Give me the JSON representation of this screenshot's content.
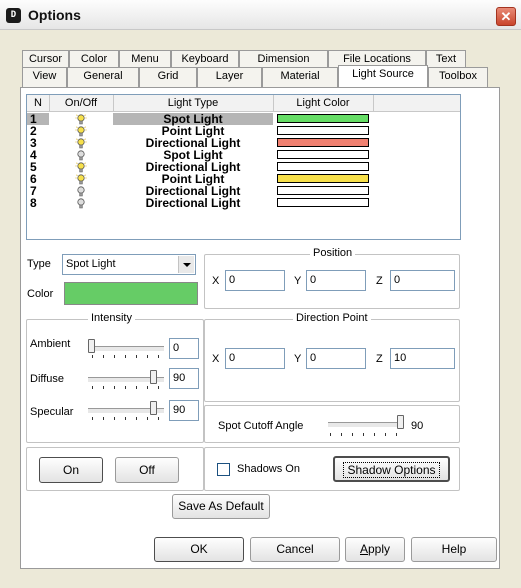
{
  "window": {
    "title": "Options",
    "app_icon": "D"
  },
  "tabs_back": [
    {
      "label": "Cursor"
    },
    {
      "label": "Color"
    },
    {
      "label": "Menu"
    },
    {
      "label": "Keyboard"
    },
    {
      "label": "Dimension"
    },
    {
      "label": "File Locations"
    },
    {
      "label": "Text"
    }
  ],
  "tabs_front": [
    {
      "label": "View"
    },
    {
      "label": "General"
    },
    {
      "label": "Grid"
    },
    {
      "label": "Layer"
    },
    {
      "label": "Material"
    },
    {
      "label": "Light Source"
    },
    {
      "label": "Toolbox"
    }
  ],
  "active_tab": "Light Source",
  "light_list": {
    "headers": [
      "N",
      "On/Off",
      "Light Type",
      "Light Color"
    ],
    "rows": [
      {
        "n": "1",
        "on": true,
        "type": "Spot Light",
        "color": "#66dd66",
        "selected": true
      },
      {
        "n": "2",
        "on": true,
        "type": "Point Light",
        "color": "#ffffff",
        "selected": false
      },
      {
        "n": "3",
        "on": true,
        "type": "Directional Light",
        "color": "#f08070",
        "selected": false
      },
      {
        "n": "4",
        "on": false,
        "type": "Spot Light",
        "color": "#ffffff",
        "selected": false
      },
      {
        "n": "5",
        "on": true,
        "type": "Directional Light",
        "color": "#ffffff",
        "selected": false
      },
      {
        "n": "6",
        "on": true,
        "type": "Point Light",
        "color": "#f7e04a",
        "selected": false
      },
      {
        "n": "7",
        "on": false,
        "type": "Directional Light",
        "color": "#ffffff",
        "selected": false
      },
      {
        "n": "8",
        "on": false,
        "type": "Directional Light",
        "color": "#ffffff",
        "selected": false
      }
    ]
  },
  "type": {
    "label": "Type",
    "value": "Spot Light"
  },
  "color": {
    "label": "Color",
    "swatch": "#66cc66"
  },
  "position": {
    "title": "Position",
    "x_label": "X",
    "x": "0",
    "y_label": "Y",
    "y": "0",
    "z_label": "Z",
    "z": "0"
  },
  "intensity": {
    "title": "Intensity",
    "ambient": {
      "label": "Ambient",
      "value": "0",
      "fraction": 0.0
    },
    "diffuse": {
      "label": "Diffuse",
      "value": "90",
      "fraction": 0.9
    },
    "specular": {
      "label": "Specular",
      "value": "90",
      "fraction": 0.9
    }
  },
  "direction": {
    "title": "Direction Point",
    "x_label": "X",
    "x": "0",
    "y_label": "Y",
    "y": "0",
    "z_label": "Z",
    "z": "10"
  },
  "spot_cutoff": {
    "label": "Spot Cutoff Angle",
    "value": "90",
    "fraction": 1.0
  },
  "onoff": {
    "on": "On",
    "off": "Off"
  },
  "shadows": {
    "label": "Shadows On",
    "checked": false,
    "options": "Shadow Options"
  },
  "save_default": "Save As Default",
  "footer": {
    "ok": "OK",
    "cancel": "Cancel",
    "apply_prefix": "A",
    "apply_rest": "pply",
    "help": "Help"
  },
  "colors": {
    "selected_row": "#b5b5b5",
    "bulb_on": "#f7e04a",
    "bulb_off": "#dddddd",
    "close": "#c9452c"
  },
  "icons": {
    "bulb": "lightbulb-icon",
    "dropdown": "chevron-down-icon",
    "close": "close-icon"
  }
}
